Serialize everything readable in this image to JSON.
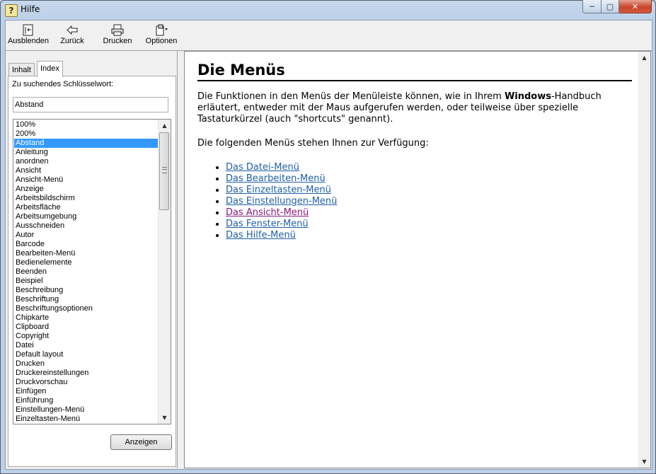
{
  "window": {
    "title": "Hilfe",
    "icon": "help-book-icon",
    "controls": {
      "minimize": "minimize-icon",
      "maximize": "maximize-icon",
      "close": "close-icon"
    }
  },
  "toolbar": {
    "buttons": [
      {
        "label": "Ausblenden",
        "icon": "hide-pane-icon"
      },
      {
        "label": "Zurück",
        "icon": "back-arrow-icon"
      },
      {
        "label": "Drucken",
        "icon": "printer-icon"
      },
      {
        "label": "Optionen",
        "icon": "options-icon"
      }
    ]
  },
  "navigation": {
    "tabs": [
      {
        "label": "Inhalt"
      },
      {
        "label": "Index"
      }
    ],
    "active_tab": "Index",
    "keyword_label": "Zu suchendes Schlüsselwort:",
    "keyword_value": "Abstand",
    "selected_keyword": "Abstand",
    "keywords": [
      "100%",
      "200%",
      "Abstand",
      "Anleitung",
      "anordnen",
      "Ansicht",
      "Ansicht-Menü",
      "Anzeige",
      "Arbeitsbildschirm",
      "Arbeitsfläche",
      "Arbeitsumgebung",
      "Ausschneiden",
      "Autor",
      "Barcode",
      "Bearbeiten-Menü",
      "Bedienelemente",
      "Beenden",
      "Beispiel",
      "Beschreibung",
      "Beschriftung",
      "Beschriftungsoptionen",
      "Chipkarte",
      "Clipboard",
      "Copyright",
      "Datei",
      "Default layout",
      "Drucken",
      "Druckereinstellungen",
      "Druckvorschau",
      "Einfügen",
      "Einführung",
      "Einstellungen-Menü",
      "Einzeltasten-Menü"
    ],
    "show_button": "Anzeigen"
  },
  "article": {
    "heading": "Die Menüs",
    "intro_before": "Die Funktionen in den Menüs der Menüleiste können, wie in Ihrem ",
    "intro_bold": "Windows",
    "intro_after": "-Handbuch erläutert, entweder mit der Maus aufgerufen werden, oder teilweise über spezielle Tastaturkürzel (auch \"shortcuts\" genannt).",
    "list_intro": "Die folgenden Menüs stehen Ihnen zur Verfügung:",
    "links": [
      {
        "label": "Das Datei-Menü",
        "visited": false
      },
      {
        "label": "Das Bearbeiten-Menü",
        "visited": false
      },
      {
        "label": "Das Einzeltasten-Menü",
        "visited": false
      },
      {
        "label": "Das Einstellungen-Menü",
        "visited": false
      },
      {
        "label": "Das Ansicht-Menü",
        "visited": true
      },
      {
        "label": "Das Fenster-Menü",
        "visited": false
      },
      {
        "label": "Das Hilfe-Menü",
        "visited": false
      }
    ]
  },
  "colors": {
    "link": "#1f5fa8",
    "visited_link": "#8a1a7a",
    "selection": "#3399ff"
  }
}
